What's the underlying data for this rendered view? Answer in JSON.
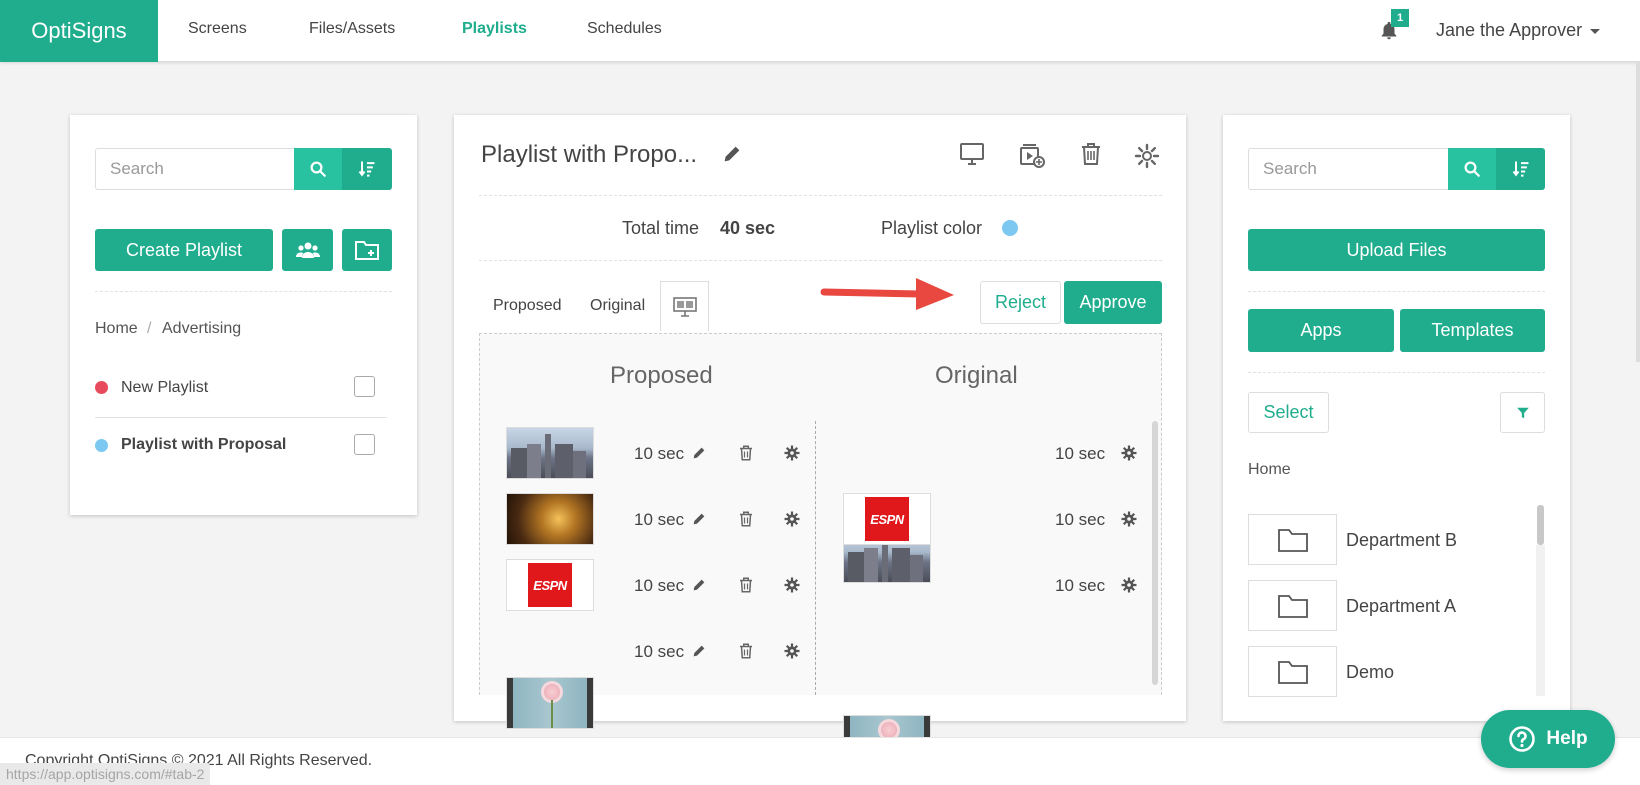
{
  "nav": {
    "brand": "OptiSigns",
    "items": [
      "Screens",
      "Files/Assets",
      "Playlists",
      "Schedules"
    ],
    "active": "Playlists",
    "notification_count": "1",
    "user": "Jane the Approver"
  },
  "left": {
    "search_placeholder": "Search",
    "create_label": "Create Playlist",
    "breadcrumb": [
      "Home",
      "Advertising"
    ],
    "playlists": [
      {
        "name": "New Playlist",
        "color": "#e84b5b"
      },
      {
        "name": "Playlist with Proposal",
        "color": "#7cc8f0"
      }
    ]
  },
  "middle": {
    "title": "Playlist with Propo...",
    "total_time_label": "Total time",
    "total_time_value": "40 sec",
    "color_label": "Playlist color",
    "color": "#7cc8f0",
    "tabs": [
      "Proposed",
      "Original"
    ],
    "reject_label": "Reject",
    "approve_label": "Approve",
    "proposed_title": "Proposed",
    "original_title": "Original",
    "proposed": [
      {
        "image": "city",
        "duration": "10 sec"
      },
      {
        "image": "bar",
        "duration": "10 sec"
      },
      {
        "image": "espn",
        "duration": "10 sec"
      },
      {
        "image": "flower",
        "duration": "10 sec"
      }
    ],
    "original": [
      {
        "image": "city",
        "duration": "10 sec"
      },
      {
        "image": "espn",
        "duration": "10 sec"
      },
      {
        "image": "flower",
        "duration": "10 sec"
      }
    ]
  },
  "right": {
    "search_placeholder": "Search",
    "upload_label": "Upload Files",
    "apps_label": "Apps",
    "templates_label": "Templates",
    "select_label": "Select",
    "breadcrumb": "Home",
    "folders": [
      "Department B",
      "Department A",
      "Demo"
    ]
  },
  "footer": {
    "copyright": "Copyright OptiSigns © 2021 All Rights Reserved.",
    "status_url": "https://app.optisigns.com/#tab-2",
    "help_label": "Help"
  },
  "colors": {
    "accent": "#1fad8e",
    "arrow": "#e8483f"
  }
}
